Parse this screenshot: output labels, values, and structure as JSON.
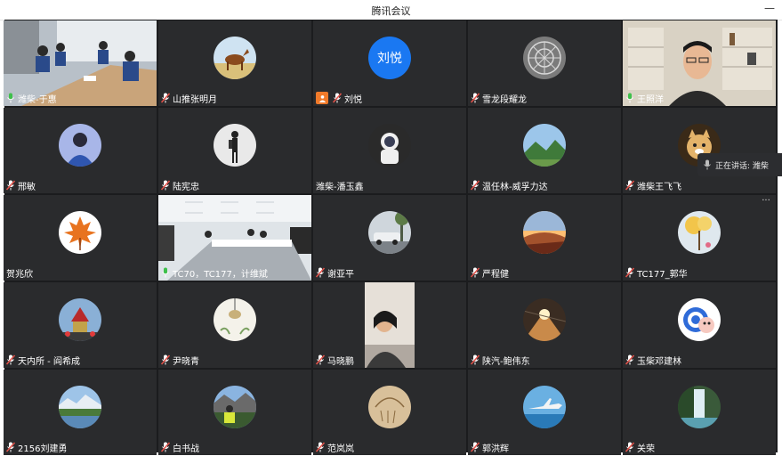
{
  "window": {
    "title": "腾讯会议",
    "minimize_icon": "minimize-icon"
  },
  "speaker_indicator": {
    "label": "正在讲话: 潍柴"
  },
  "colors": {
    "background": "#1b1c1e",
    "tile": "#2a2b2d",
    "mic_active": "#3ec04b",
    "mic_muted": "#e0524a",
    "host_badge": "#f07a2a",
    "text_avatar": "#1a78f2"
  },
  "participants": [
    {
      "name": "潍柴-于惠",
      "mic": "active",
      "tile": "video-meeting-room"
    },
    {
      "name": "山推张明月",
      "mic": "muted",
      "tile": "avatar-horse"
    },
    {
      "name": "刘悦",
      "mic": "muted",
      "tile": "avatar-text",
      "avatar_text": "刘悦",
      "badge": "host"
    },
    {
      "name": "雪龙段耀龙",
      "mic": "muted",
      "tile": "avatar-dome"
    },
    {
      "name": "王照洋",
      "mic": "active",
      "tile": "video-man-office"
    },
    {
      "name": "邢敏",
      "mic": "muted",
      "tile": "avatar-person-blue"
    },
    {
      "name": "陆宪忠",
      "mic": "muted",
      "tile": "avatar-hiker"
    },
    {
      "name": "潍柴-潘玉鑫",
      "mic": "none",
      "tile": "avatar-astronaut"
    },
    {
      "name": "温任林-威孚力达",
      "mic": "muted",
      "tile": "avatar-mountain"
    },
    {
      "name": "潍柴王飞飞",
      "mic": "muted",
      "tile": "avatar-cat"
    },
    {
      "name": "贺兆欣",
      "mic": "none",
      "tile": "avatar-maple"
    },
    {
      "name": "TC70，TC177，计维斌",
      "mic": "active",
      "tile": "video-conference-room"
    },
    {
      "name": "谢亚平",
      "mic": "muted",
      "tile": "avatar-car"
    },
    {
      "name": "严程健",
      "mic": "muted",
      "tile": "avatar-sunset"
    },
    {
      "name": "TC177_郭华",
      "mic": "muted",
      "tile": "avatar-flowers",
      "more": true
    },
    {
      "name": "天内所 - 阎希成",
      "mic": "muted",
      "tile": "avatar-temple"
    },
    {
      "name": "尹晓青",
      "mic": "muted",
      "tile": "avatar-lamp"
    },
    {
      "name": "马晓鹏",
      "mic": "muted",
      "tile": "video-woman"
    },
    {
      "name": "陕汽-鲍伟东",
      "mic": "muted",
      "tile": "avatar-station"
    },
    {
      "name": "玉柴邓建林",
      "mic": "muted",
      "tile": "avatar-cartoon"
    },
    {
      "name": "2156刘建勇",
      "mic": "muted",
      "tile": "avatar-lake"
    },
    {
      "name": "白书战",
      "mic": "muted",
      "tile": "avatar-mountain-person"
    },
    {
      "name": "范岚岚",
      "mic": "muted",
      "tile": "avatar-hand"
    },
    {
      "name": "郭洪辉",
      "mic": "muted",
      "tile": "avatar-plane"
    },
    {
      "name": "关荣",
      "mic": "muted",
      "tile": "avatar-waterfall"
    }
  ]
}
